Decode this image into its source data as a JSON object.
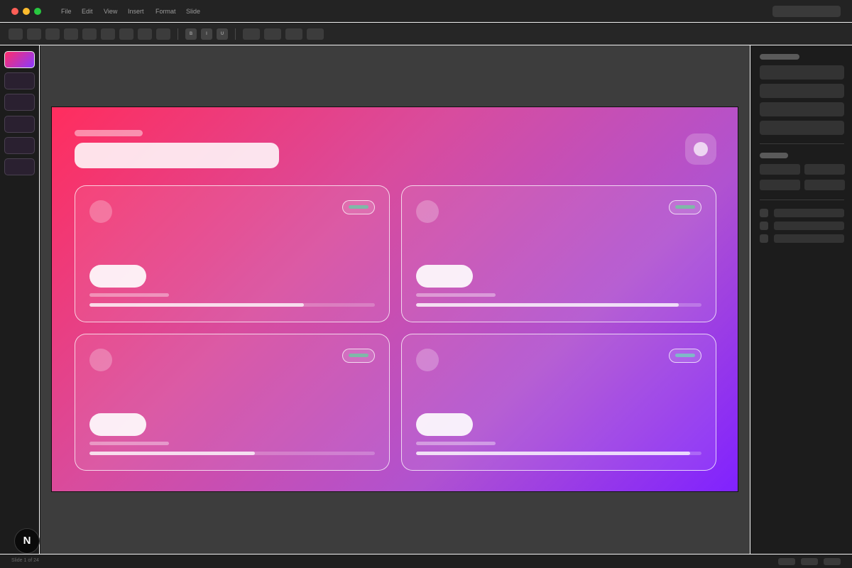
{
  "titlebar": {
    "menus": [
      "File",
      "Edit",
      "View",
      "Insert",
      "Format",
      "Slide"
    ],
    "traffic_light_colors": [
      "#ff5f57",
      "#febc2e",
      "#28c840"
    ]
  },
  "toolbar": {
    "format_buttons": [
      "B",
      "I",
      "U"
    ]
  },
  "slides": {
    "count_visible": 6,
    "active_index": 0
  },
  "slide": {
    "gradient_colors": [
      "#ff2d5e",
      "#8022ff"
    ],
    "cards": [
      {
        "progress": 0.75,
        "badge_color": "#7fb8a8"
      },
      {
        "progress": 0.92,
        "badge_color": "#7fb8a8"
      },
      {
        "progress": 0.58,
        "badge_color": "#7fb8a8"
      },
      {
        "progress": 0.96,
        "badge_color": "#7fb8c8"
      }
    ]
  },
  "status": {
    "text": "Slide 1 of 24"
  },
  "badge": {
    "letter": "N"
  }
}
